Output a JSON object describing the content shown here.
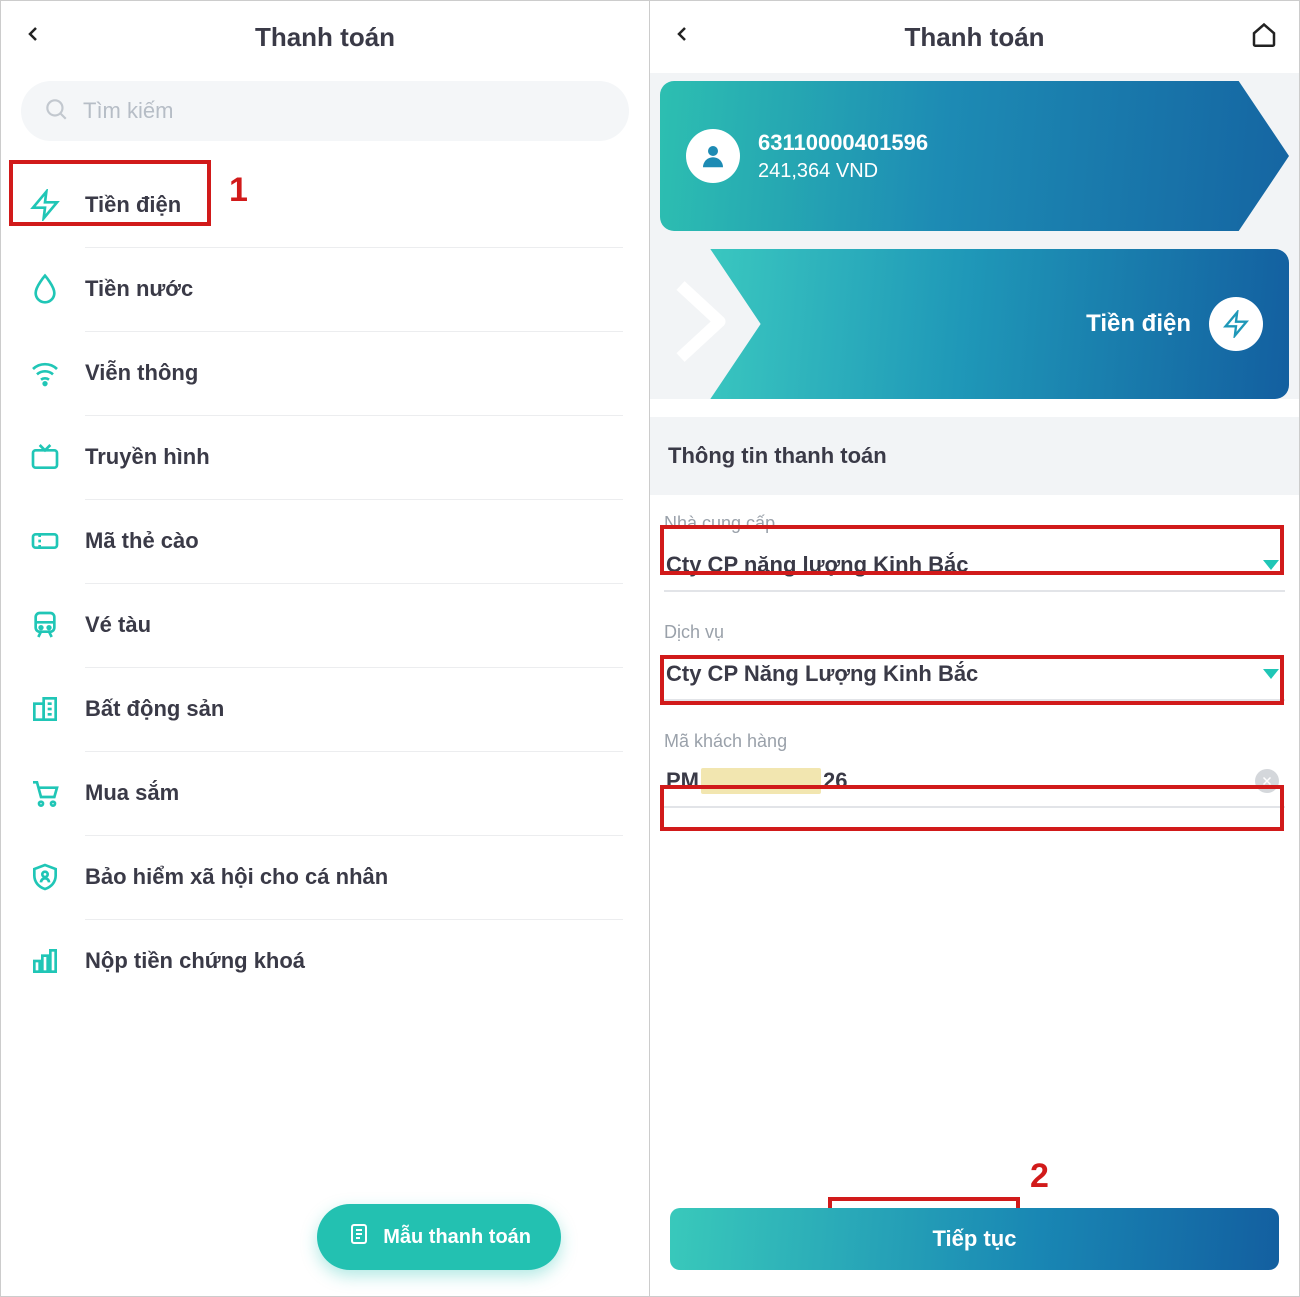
{
  "colors": {
    "accent": "#20c6b6",
    "danger": "#d11a1a",
    "gradientStart": "#3fd0c1",
    "gradientEnd": "#135fa0"
  },
  "left": {
    "header": {
      "title": "Thanh toán"
    },
    "search": {
      "placeholder": "Tìm kiếm"
    },
    "menu": [
      {
        "label": "Tiền điện",
        "icon": "bolt-icon"
      },
      {
        "label": "Tiền nước",
        "icon": "drop-icon"
      },
      {
        "label": "Viễn thông",
        "icon": "wifi-icon"
      },
      {
        "label": "Truyền hình",
        "icon": "tv-icon"
      },
      {
        "label": "Mã thẻ cào",
        "icon": "ticket-icon"
      },
      {
        "label": "Vé tàu",
        "icon": "train-icon"
      },
      {
        "label": "Bất động sản",
        "icon": "building-icon"
      },
      {
        "label": "Mua sắm",
        "icon": "cart-icon"
      },
      {
        "label": "Bảo hiểm xã hội cho cá nhân",
        "icon": "shield-icon"
      },
      {
        "label": "Nộp tiền chứng khoá",
        "icon": "chart-icon"
      }
    ],
    "fab": "Mẫu thanh toán",
    "annotation1": "1"
  },
  "right": {
    "header": {
      "title": "Thanh toán"
    },
    "account": {
      "number": "63110000401596",
      "balance": "241,364 VND"
    },
    "serviceCard": {
      "label": "Tiền điện"
    },
    "sectionTitle": "Thông tin thanh toán",
    "form": {
      "providerLabel": "Nhà cung cấp",
      "providerValue": "Cty CP năng lượng Kinh Bắc",
      "serviceLabel": "Dịch vụ",
      "serviceValue": "Cty CP Năng Lượng Kinh Bắc",
      "customerCodeLabel": "Mã khách hàng",
      "customerCodePrefix": "PM",
      "customerCodeSuffix": "26"
    },
    "continue": "Tiếp tục",
    "annotation2": "2"
  }
}
